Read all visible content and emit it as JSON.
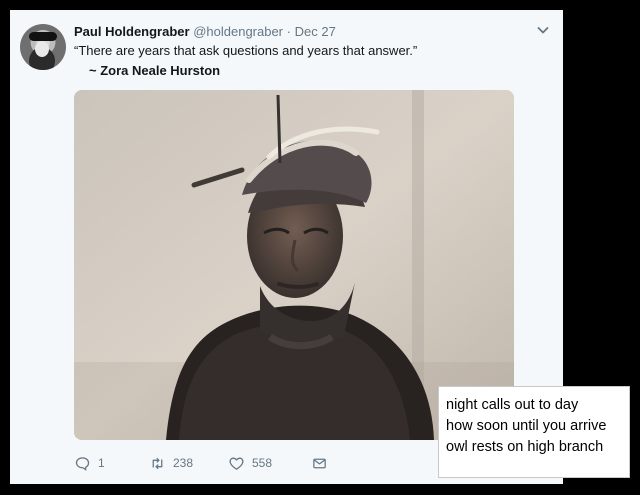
{
  "tweet": {
    "author_name": "Paul Holdengraber",
    "handle": "@holdengraber",
    "separator": "·",
    "date": "Dec 27",
    "text": "“There are years that ask questions and years that answer.”",
    "attribution": "~ Zora Neale Hurston",
    "reply_count": "1",
    "retweet_count": "238",
    "like_count": "558"
  },
  "haiku": {
    "lines": [
      "night calls out to day",
      "how soon until you arrive",
      "owl rests on high branch"
    ]
  },
  "icons": {
    "avatar": "avatar",
    "caret": "chevron-down-icon",
    "reply": "reply-icon",
    "retweet": "retweet-icon",
    "like": "heart-icon",
    "message": "mail-icon"
  }
}
